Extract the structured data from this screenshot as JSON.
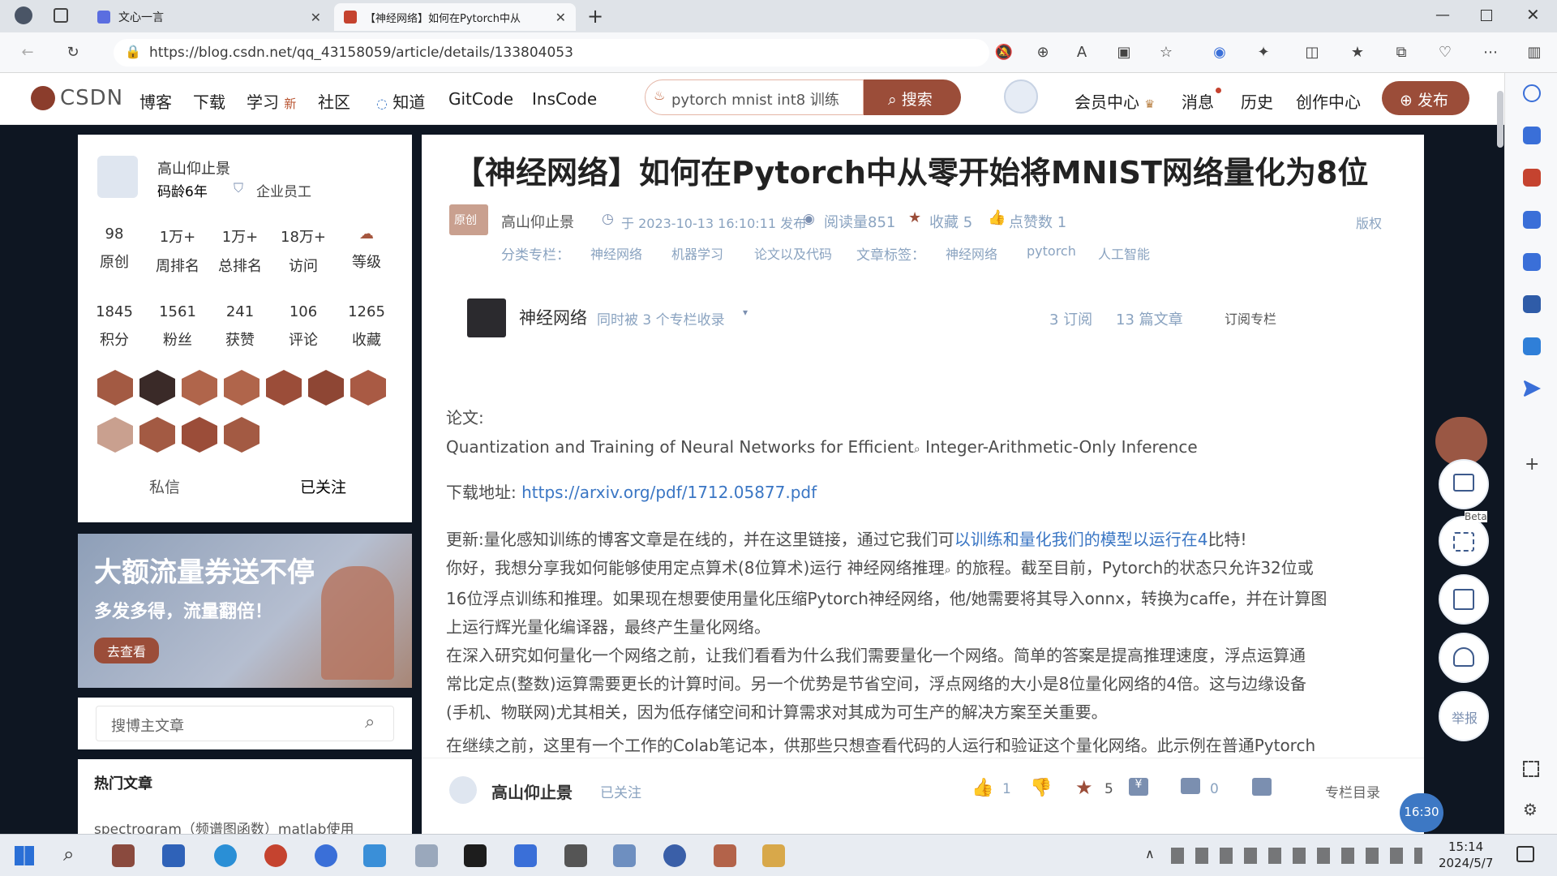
{
  "browser": {
    "tabs": [
      {
        "title": "文心一言"
      },
      {
        "title": "【神经网络】如何在Pytorch中从"
      }
    ],
    "url": "https://blog.csdn.net/qq_43158059/article/details/133804053"
  },
  "nav": {
    "logo": "CSDN",
    "links": [
      "博客",
      "下载",
      "学习",
      "社区",
      "知道",
      "GitCode",
      "InsCode"
    ],
    "new_badge": "新",
    "search_value": "pytorch mnist int8 训练",
    "search_button": "搜索",
    "right_links": [
      "会员中心",
      "消息",
      "历史",
      "创作中心"
    ],
    "publish_button": "发布"
  },
  "author": {
    "name": "高山仰止景",
    "age": "码龄6年",
    "badge": "企业员工",
    "stats_row1": [
      {
        "value": "98",
        "label": "原创"
      },
      {
        "value": "1万+",
        "label": "周排名"
      },
      {
        "value": "1万+",
        "label": "总排名"
      },
      {
        "value": "18万+",
        "label": "访问"
      },
      {
        "value": "",
        "label": "等级"
      }
    ],
    "stats_row2": [
      {
        "value": "1845",
        "label": "积分"
      },
      {
        "value": "1561",
        "label": "粉丝"
      },
      {
        "value": "241",
        "label": "获赞"
      },
      {
        "value": "106",
        "label": "评论"
      },
      {
        "value": "1265",
        "label": "收藏"
      }
    ],
    "message_button": "私信",
    "follow_button": "已关注"
  },
  "ad": {
    "title": "大额流量券送不停",
    "subtitle": "多发多得，流量翻倍！",
    "button": "去查看"
  },
  "blog_search": {
    "placeholder": "搜博主文章"
  },
  "hot": {
    "title": "热门文章",
    "first_item": "spectrogram（频谱图函数）matlab使用"
  },
  "article": {
    "title": "【神经网络】如何在Pytorch中从零开始将MNIST网络量化为8位",
    "original_tag": "原创",
    "author": "高山仰止景",
    "date": "于 2023-10-13 16:10:11 发布",
    "reads": "阅读量851",
    "favorites": "收藏 5",
    "likes": "点赞数 1",
    "copyright": "版权",
    "category_label": "分类专栏：",
    "categories": [
      "神经网络",
      "机器学习",
      "论文以及代码"
    ],
    "tag_label": "文章标签：",
    "tags": [
      "神经网络",
      "pytorch",
      "人工智能"
    ],
    "column": {
      "name": "神经网络",
      "collected": "同时被 3 个专栏收录",
      "subs": "3 订阅",
      "articles": "13 篇文章",
      "subscribe": "订阅专栏"
    },
    "paper_label": "论文:",
    "paper_title_a": "Quantization and Training of Neural Networks for  Efficient",
    "paper_title_b": " Integer-Arithmetic-Only Inference",
    "download_label": "下载地址:",
    "download_url": "https://arxiv.org/pdf/1712.05877.pdf",
    "update_prefix": "更新:量化感知训练的博客文章是在线的，并在这里链接，通过它我们可",
    "update_link": "以训练和量化我们的模型以运行在4",
    "update_suffix": "比特!",
    "p1a": "你好，我想分享我如何能够使用定点算术(8位算术)运行 神经网络推理",
    "p1b": " 的旅程。截至目前，Pytorch的状态只允许32位或",
    "p1c": "16位浮点训练和推理。如果现在想要使用量化压缩Pytorch神经网络，他/她需要将其导入onnx，转换为caffe，并在计算图",
    "p1d": "上运行辉光量化编译器，最终产生量化网络。",
    "p2a": "在深入研究如何量化一个网络之前，让我们看看为什么我们需要量化一个网络。简单的答案是提高推理速度，浮点运算通",
    "p2b": "常比定点(整数)运算需要更长的计算时间。另一个优势是节省空间，浮点网络的大小是8位量化网络的4倍。这与边缘设备",
    "p2c": "(手机、物联网)尤其相关，因为低存储空间和计算需求对其成为可生产的解决方案至关重要。",
    "p3": "在继续之前，这里有一个工作的Colab笔记本，供那些只想查看代码的人运行和验证这个量化网络。此示例在普通Pytorch"
  },
  "bottom_bar": {
    "author": "高山仰止景",
    "followed": "已关注",
    "likes": "1",
    "stars": "5",
    "comments": "0",
    "toc": "专栏目录",
    "time_badge": "16:30"
  },
  "floating": {
    "beta": "Beta",
    "report": "举报"
  },
  "taskbar": {
    "time": "15:14",
    "date": "2024/5/7"
  }
}
